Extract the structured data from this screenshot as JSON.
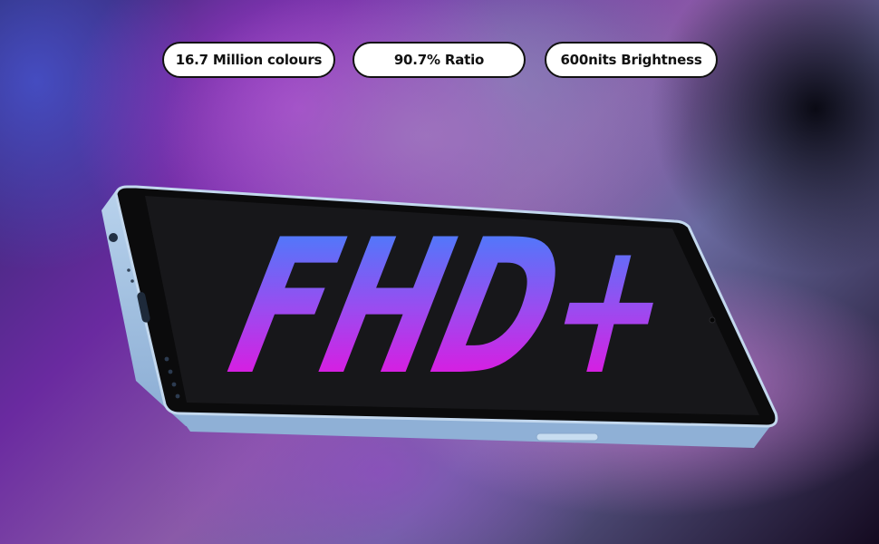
{
  "features": [
    {
      "label": "16.7 Million colours"
    },
    {
      "label": "90.7% Ratio"
    },
    {
      "label": "600nits Brightness"
    }
  ],
  "screen": {
    "headline": "FHD+"
  },
  "colors": {
    "headline_top": "#2f8cff",
    "headline_bottom": "#ff00d8",
    "phone_frame": "#a9c6e6",
    "screen": "#161618"
  }
}
